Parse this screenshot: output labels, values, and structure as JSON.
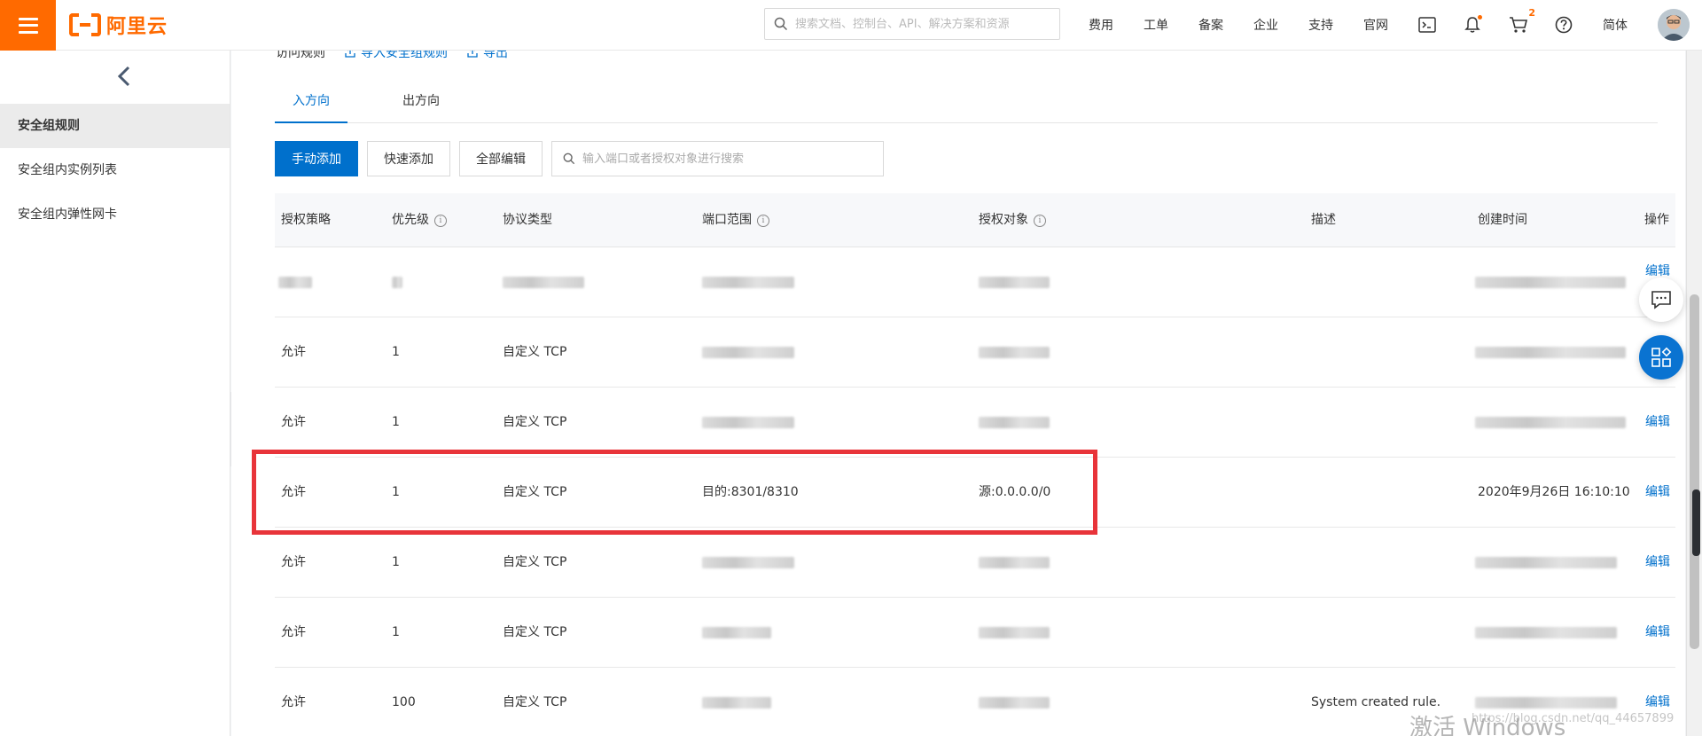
{
  "header": {
    "logo_text": "阿里云",
    "search_placeholder": "搜索文档、控制台、API、解决方案和资源",
    "nav": [
      "费用",
      "工单",
      "备案",
      "企业",
      "支持",
      "官网"
    ],
    "cart_count": "2",
    "language": "简体",
    "icons": [
      "menu-icon",
      "search-icon",
      "terminal-icon",
      "bell-icon",
      "cart-icon",
      "help-icon"
    ],
    "accent_color": "#ff6a00"
  },
  "sidebar": {
    "items": [
      {
        "label": "安全组规则",
        "active": true
      },
      {
        "label": "安全组内实例列表",
        "active": false
      },
      {
        "label": "安全组内弹性网卡",
        "active": false
      }
    ]
  },
  "main": {
    "section_title": "访问规则",
    "import_label": "导入安全组规则",
    "export_label": "导出",
    "tabs": [
      {
        "label": "入方向",
        "active": true
      },
      {
        "label": "出方向",
        "active": false
      }
    ],
    "toolbar": {
      "manual_add": "手动添加",
      "quick_add": "快速添加",
      "edit_all": "全部编辑",
      "filter_placeholder": "输入端口或者授权对象进行搜索"
    },
    "primary_color": "#0070cc",
    "table": {
      "columns": [
        "授权策略",
        "优先级",
        "协议类型",
        "端口范围",
        "授权对象",
        "描述",
        "创建时间",
        "操作"
      ],
      "rows": [
        {
          "policy": "",
          "priority": "",
          "protocol": "",
          "port": "",
          "source": "",
          "desc": "",
          "created": "",
          "action": "编辑"
        },
        {
          "policy": "允许",
          "priority": "1",
          "protocol": "自定义 TCP",
          "port": "",
          "source": "",
          "desc": "",
          "created": "",
          "action": ""
        },
        {
          "policy": "允许",
          "priority": "1",
          "protocol": "自定义 TCP",
          "port": "",
          "source": "",
          "desc": "",
          "created": "",
          "action": "编辑"
        },
        {
          "policy": "允许",
          "priority": "1",
          "protocol": "自定义 TCP",
          "port": "目的:8301/8310",
          "source": "源:0.0.0.0/0",
          "desc": "",
          "created": "2020年9月26日 16:10:10",
          "action": "编辑"
        },
        {
          "policy": "允许",
          "priority": "1",
          "protocol": "自定义 TCP",
          "port": "",
          "source": "",
          "desc": "",
          "created": "",
          "action": "编辑"
        },
        {
          "policy": "允许",
          "priority": "1",
          "protocol": "自定义 TCP",
          "port": "",
          "source": "",
          "desc": "",
          "created": "",
          "action": "编辑"
        },
        {
          "policy": "允许",
          "priority": "100",
          "protocol": "自定义 TCP",
          "port": "",
          "source": "",
          "desc": "System created rule.",
          "created": "",
          "action": "编辑"
        }
      ]
    }
  },
  "watermark": {
    "text": "激活 Windows",
    "url": "https://blog.csdn.net/qq_44657899"
  }
}
